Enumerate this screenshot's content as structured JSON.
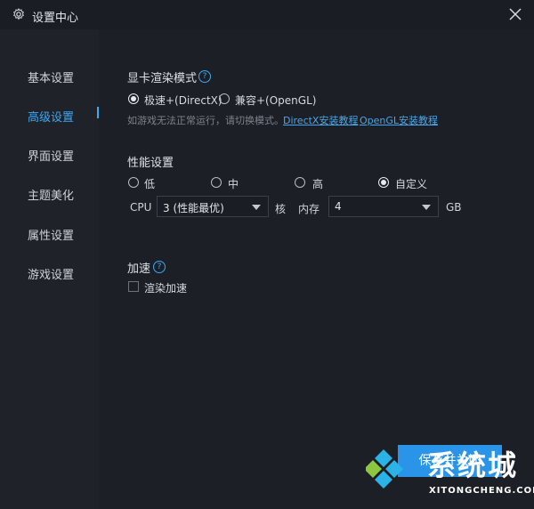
{
  "window": {
    "title": "设置中心",
    "close_icon": "close-icon",
    "title_icon": "gear-icon"
  },
  "sidebar": {
    "items": [
      {
        "label": "基本设置",
        "active": false
      },
      {
        "label": "高级设置",
        "active": true
      },
      {
        "label": "界面设置",
        "active": false
      },
      {
        "label": "主题美化",
        "active": false
      },
      {
        "label": "属性设置",
        "active": false
      },
      {
        "label": "游戏设置",
        "active": false
      }
    ]
  },
  "render": {
    "title": "显卡渲染模式",
    "options": [
      {
        "label": "极速+(DirectX)",
        "checked": true
      },
      {
        "label": "兼容+(OpenGL)",
        "checked": false
      }
    ],
    "hint": "如游戏无法正常运行，请切换模式。",
    "links": [
      "DirectX安装教程",
      "OpenGL安装教程"
    ]
  },
  "performance": {
    "title": "性能设置",
    "options": [
      {
        "label": "低",
        "checked": false
      },
      {
        "label": "中",
        "checked": false
      },
      {
        "label": "高",
        "checked": false
      },
      {
        "label": "自定义",
        "checked": true
      }
    ],
    "cpu_label": "CPU",
    "cpu_value": "3 (性能最优)",
    "cpu_unit": "核",
    "mem_label": "内存",
    "mem_value": "4",
    "mem_unit": "GB"
  },
  "accelerate": {
    "title": "加速",
    "checkbox_label": "渲染加速",
    "checked": false
  },
  "footer": {
    "save_label": "保存并关闭"
  },
  "watermark": {
    "text": "系统城",
    "url": "XITONGCHENG.COM"
  },
  "colors": {
    "accent": "#3ea8f2",
    "button": "#2a95e8",
    "background": "#1c1f26"
  }
}
